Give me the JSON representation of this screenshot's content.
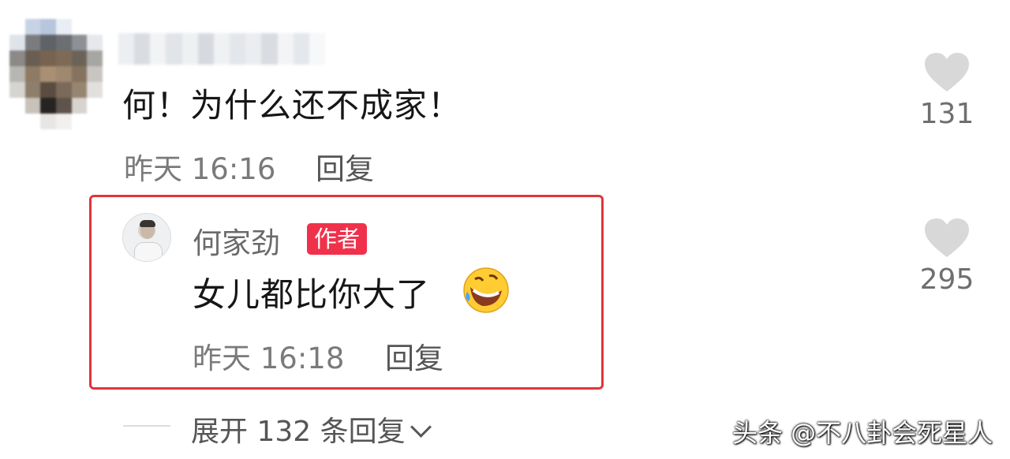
{
  "top_comment": {
    "text": "何！为什么还不成家！",
    "time": "昨天 16:16",
    "reply_label": "回复",
    "like_count": "131"
  },
  "author_reply": {
    "author_name": "何家劲",
    "badge": "作者",
    "text": "女儿都比你大了",
    "emoji": "rolling-on-floor-laughing-emoji",
    "time": "昨天 16:18",
    "reply_label": "回复",
    "like_count": "295"
  },
  "expand": {
    "label": "展开 132 条回复"
  },
  "watermark": "头条 @不八卦会死星人",
  "colors": {
    "highlight_border": "#e0353b",
    "badge_bg": "#f0314b",
    "heart": "#d8d8d8"
  }
}
